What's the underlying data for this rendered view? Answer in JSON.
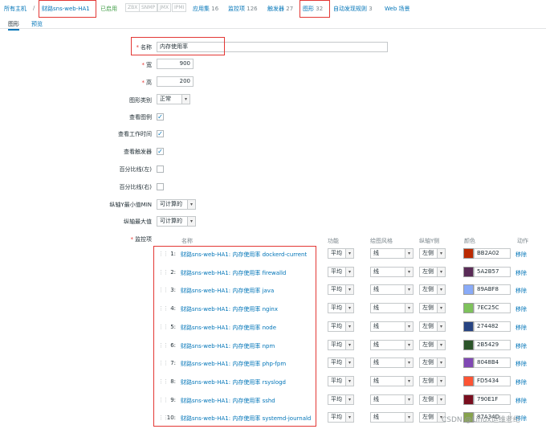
{
  "breadcrumb": {
    "all_hosts": "所有主机",
    "separator": "/",
    "host": "财路sns-web-HA1",
    "enabled": "已启用",
    "tag_zbx": "ZBX",
    "tag_snmp": "SNMP",
    "tag_jmx": "JMX",
    "tag_ipmi": "IPMI",
    "applications": "应用集",
    "applications_count": "16",
    "items": "监控项",
    "items_count": "126",
    "triggers": "触发器",
    "triggers_count": "27",
    "graphs": "图形",
    "graphs_count": "32",
    "discovery": "自动发现规则",
    "discovery_count": "3",
    "web": "Web 场景"
  },
  "tabs": {
    "graph": "图形",
    "preview": "预览"
  },
  "form": {
    "name_label": "名称",
    "name_value": "内存使用率",
    "width_label": "宽",
    "width_value": "900",
    "height_label": "高",
    "height_value": "200",
    "type_label": "图形类别",
    "type_value": "正常",
    "show_legend_label": "查看图例",
    "show_legend": true,
    "show_worktime_label": "查看工作时间",
    "show_worktime": true,
    "show_triggers_label": "查看触发器",
    "show_triggers": true,
    "percent_left_label": "百分比线(左)",
    "percent_left": false,
    "percent_right_label": "百分比线(右)",
    "percent_right": false,
    "ymin_label": "纵轴Y最小值MIN",
    "ymin_value": "可计算的",
    "ymax_label": "纵轴最大值",
    "ymax_value": "可计算的",
    "items_label": "监控项"
  },
  "items_table": {
    "headers": {
      "name": "名称",
      "function": "功能",
      "style": "绘图风格",
      "yaxis": "纵轴Y侧",
      "color": "颜色",
      "action": "动作"
    },
    "rows": [
      {
        "idx": "1:",
        "name": "财路sns-web-HA1: 内存使用率 dockerd-current",
        "function": "平均",
        "style": "线",
        "yaxis": "左侧",
        "color": "BB2A02",
        "action": "移除"
      },
      {
        "idx": "2:",
        "name": "财路sns-web-HA1: 内存使用率 firewalld",
        "function": "平均",
        "style": "线",
        "yaxis": "左侧",
        "color": "5A2B57",
        "action": "移除"
      },
      {
        "idx": "3:",
        "name": "财路sns-web-HA1: 内存使用率 java",
        "function": "平均",
        "style": "线",
        "yaxis": "左侧",
        "color": "89ABF8",
        "action": "移除"
      },
      {
        "idx": "4:",
        "name": "财路sns-web-HA1: 内存使用率 nginx",
        "function": "平均",
        "style": "线",
        "yaxis": "左侧",
        "color": "7EC25C",
        "action": "移除"
      },
      {
        "idx": "5:",
        "name": "财路sns-web-HA1: 内存使用率 node",
        "function": "平均",
        "style": "线",
        "yaxis": "左侧",
        "color": "274482",
        "action": "移除"
      },
      {
        "idx": "6:",
        "name": "财路sns-web-HA1: 内存使用率 npm",
        "function": "平均",
        "style": "线",
        "yaxis": "左侧",
        "color": "2B5429",
        "action": "移除"
      },
      {
        "idx": "7:",
        "name": "财路sns-web-HA1: 内存使用率 php-fpm",
        "function": "平均",
        "style": "线",
        "yaxis": "左侧",
        "color": "8048B4",
        "action": "移除"
      },
      {
        "idx": "8:",
        "name": "财路sns-web-HA1: 内存使用率 rsyslogd",
        "function": "平均",
        "style": "线",
        "yaxis": "左侧",
        "color": "FD5434",
        "action": "移除"
      },
      {
        "idx": "9:",
        "name": "财路sns-web-HA1: 内存使用率 sshd",
        "function": "平均",
        "style": "线",
        "yaxis": "左侧",
        "color": "790E1F",
        "action": "移除"
      },
      {
        "idx": "10:",
        "name": "财路sns-web-HA1: 内存使用率 systemd-journald",
        "function": "平均",
        "style": "线",
        "yaxis": "左侧",
        "color": "87A34D",
        "action": "移除"
      }
    ]
  },
  "watermark": "CSDN @Linux运维老纪"
}
